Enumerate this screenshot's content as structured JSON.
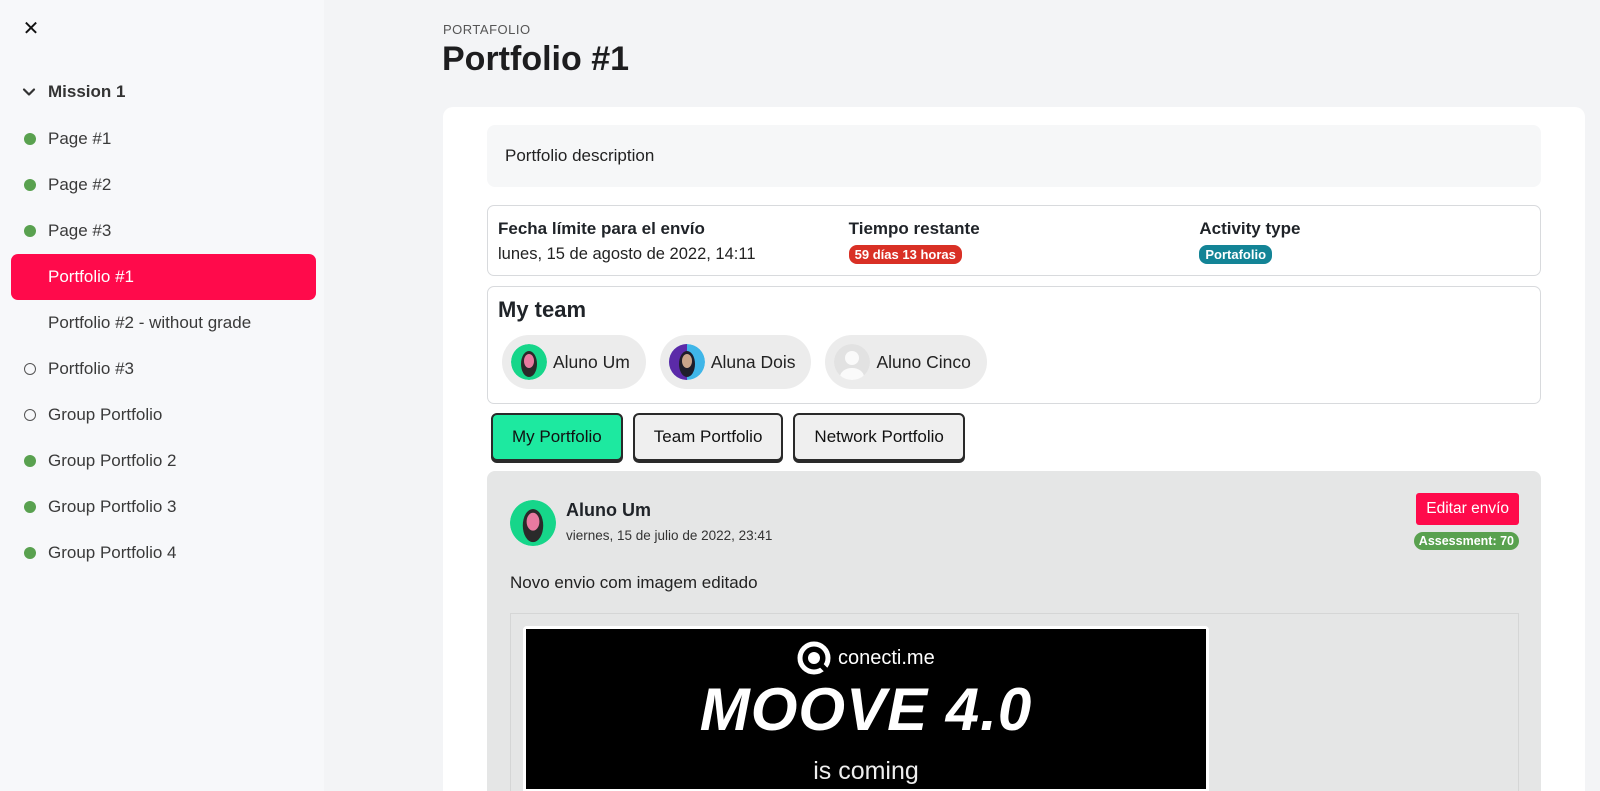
{
  "sidebar": {
    "close_icon": "close-icon",
    "section_title": "Mission 1",
    "items": [
      {
        "label": "Page #1",
        "status": "done"
      },
      {
        "label": "Page #2",
        "status": "done"
      },
      {
        "label": "Page #3",
        "status": "done"
      },
      {
        "label": "Portfolio #1",
        "status": "active"
      },
      {
        "label": "Portfolio #2 - without grade",
        "status": "none"
      },
      {
        "label": "Portfolio #3",
        "status": "open"
      },
      {
        "label": "Group Portfolio",
        "status": "open"
      },
      {
        "label": "Group Portfolio 2",
        "status": "done"
      },
      {
        "label": "Group Portfolio 3",
        "status": "done"
      },
      {
        "label": "Group Portfolio 4",
        "status": "done"
      }
    ]
  },
  "header": {
    "eyebrow": "PORTAFOLIO",
    "title": "Portfolio #1"
  },
  "description": "Portfolio description",
  "meta": {
    "deadline_label": "Fecha límite para el envío",
    "deadline_value": "lunes, 15 de agosto de 2022, 14:11",
    "remaining_label": "Tiempo restante",
    "remaining_value": "59 días 13 horas",
    "type_label": "Activity type",
    "type_value": "Portafolio"
  },
  "team": {
    "title": "My team",
    "members": [
      {
        "name": "Aluno Um"
      },
      {
        "name": "Aluna Dois"
      },
      {
        "name": "Aluno Cinco"
      }
    ]
  },
  "tabs": [
    "My Portfolio",
    "Team Portfolio",
    "Network Portfolio"
  ],
  "submission": {
    "author": "Aluno Um",
    "date": "viernes, 15 de julio de 2022, 23:41",
    "edit_label": "Editar envío",
    "assessment": "Assessment: 70",
    "text": "Novo envio com imagem editado",
    "image": {
      "logo_text": "conecti.me",
      "title": "MOOVE 4.0",
      "subtitle": "is coming"
    }
  },
  "colors": {
    "accent": "#ff0a4b",
    "success": "#59a14f",
    "tab_active": "#1de9a0",
    "badge_red": "#d93025",
    "badge_teal": "#138496"
  }
}
